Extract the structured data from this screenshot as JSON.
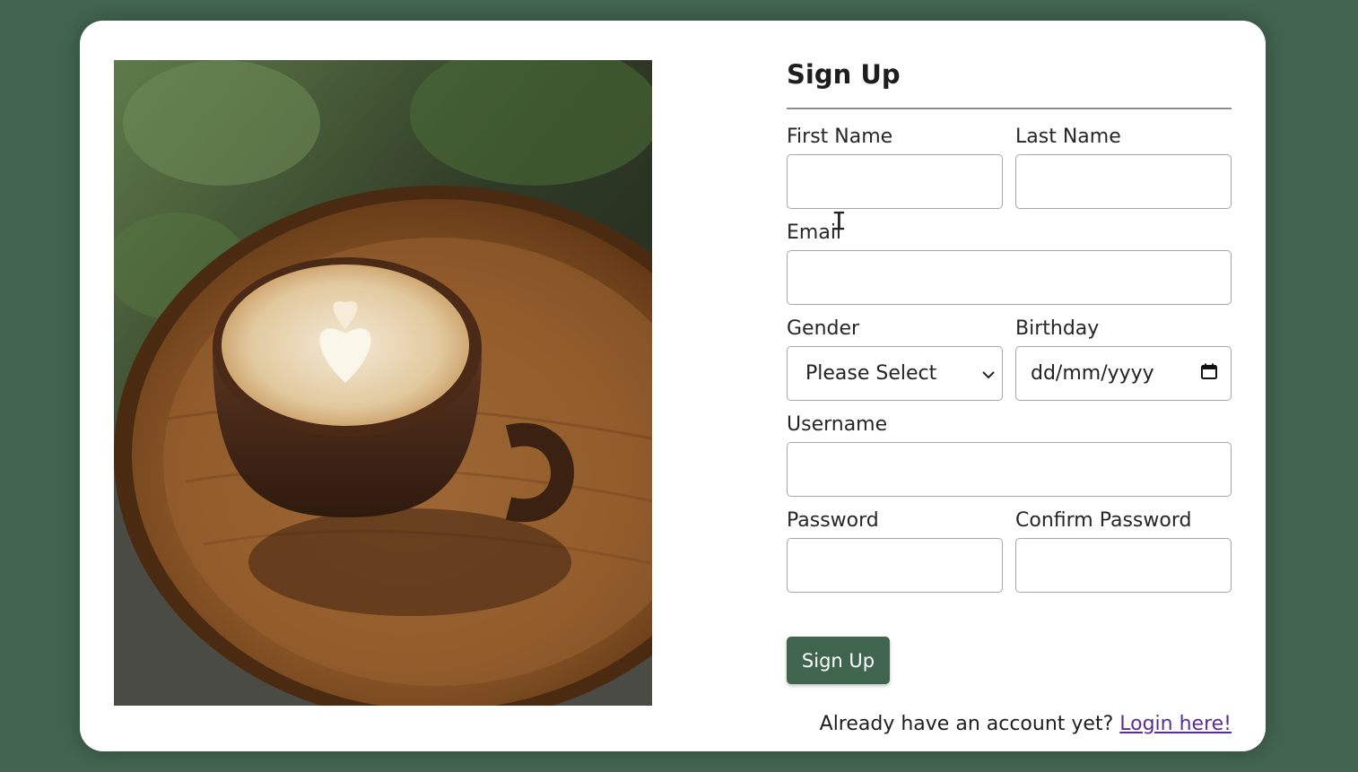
{
  "form": {
    "title": "Sign Up",
    "fields": {
      "first_name": {
        "label": "First Name",
        "value": ""
      },
      "last_name": {
        "label": "Last Name",
        "value": ""
      },
      "email": {
        "label": "Email",
        "value": ""
      },
      "gender": {
        "label": "Gender",
        "selected": "Please Select"
      },
      "birthday": {
        "label": "Birthday",
        "placeholder": "dd/mm/yyyy"
      },
      "username": {
        "label": "Username",
        "value": ""
      },
      "password": {
        "label": "Password",
        "value": ""
      },
      "confirm_password": {
        "label": "Confirm Password",
        "value": ""
      }
    },
    "submit_label": "Sign Up",
    "footer_text": "Already have an account yet?",
    "login_link": "Login here!"
  },
  "colors": {
    "background": "#41634f",
    "button": "#3f654e",
    "link": "#5c2d91"
  },
  "icons": {
    "select_arrow": "chevron-down-icon",
    "date_picker": "calendar-icon",
    "cursor": "text-cursor-icon"
  }
}
